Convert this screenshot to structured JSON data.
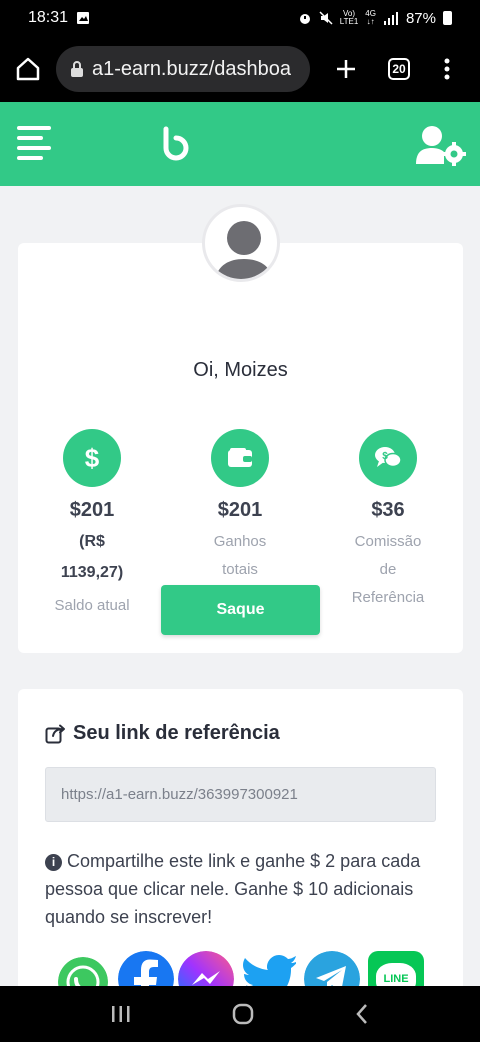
{
  "status_bar": {
    "time": "18:31",
    "battery": "87%"
  },
  "browser": {
    "url": "a1-earn.buzz/dashboa",
    "tab_count": "20"
  },
  "profile": {
    "greeting": "Oi, Moizes",
    "stats": [
      {
        "icon": "dollar-icon",
        "value": "$201",
        "sub": [
          "(R$",
          "1139,27)"
        ],
        "label": [
          "Saldo atual"
        ]
      },
      {
        "icon": "wallet-icon",
        "value": "$201",
        "sub": [],
        "label": [
          "Ganhos",
          "totais"
        ]
      },
      {
        "icon": "commission-icon",
        "value": "$36",
        "sub": [],
        "label": [
          "Comissão",
          "de",
          "Referência"
        ]
      }
    ],
    "withdraw_label": "Saque"
  },
  "referral": {
    "title": "Seu link de referência",
    "link_value": "https://a1-earn.buzz/363997300921",
    "note": "Compartilhe este link e ganhe $ 2 para cada pessoa que clicar nele. Ganhe $ 10 adicionais quando se inscrever!",
    "share_icons": [
      "whatsapp-icon",
      "facebook-icon",
      "messenger-icon",
      "twitter-icon",
      "telegram-icon",
      "line-icon"
    ],
    "line_label": "LINE"
  },
  "colors": {
    "accent": "#32c987",
    "text_dark": "#2a2e3a",
    "text_muted": "#9ea3ae"
  }
}
